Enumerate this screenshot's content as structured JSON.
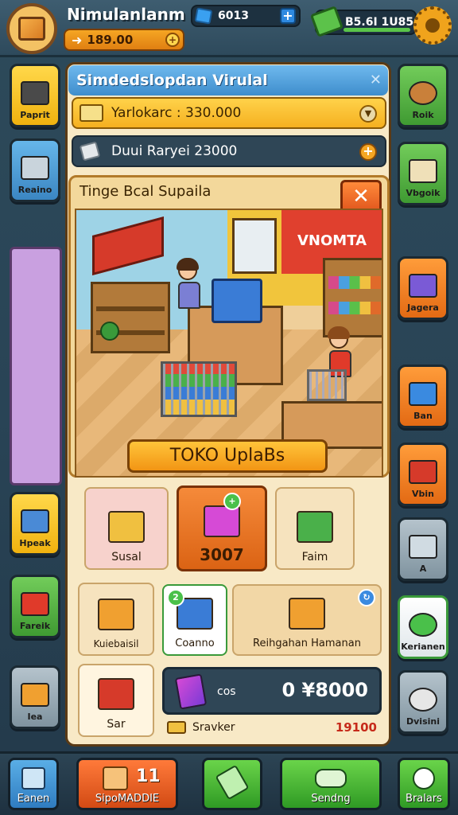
{
  "player": {
    "name": "Nimulanlanm",
    "coins": "189.00",
    "gems": "6013",
    "cash": "B5.6I 1U85"
  },
  "left_sidebar": [
    {
      "label": "Paprit",
      "icon": "trash-bin-icon",
      "color": "yellow"
    },
    {
      "label": "Reaino",
      "icon": "shopping-cart-icon",
      "color": "blue"
    },
    {
      "label": "Hpeak",
      "icon": "water-cooler-icon",
      "color": "yellow"
    },
    {
      "label": "Fareik",
      "icon": "cash-box-icon",
      "color": "green"
    },
    {
      "label": "Iea",
      "icon": "basket-icon",
      "color": "gray"
    }
  ],
  "right_sidebar": [
    {
      "label": "Roik",
      "icon": "dog-icon",
      "color": "green"
    },
    {
      "label": "Vbgoik",
      "icon": "paper-bag-icon",
      "color": "green"
    },
    {
      "label": "Jagera",
      "icon": "purple-box-icon",
      "color": "orange"
    },
    {
      "label": "Ban",
      "icon": "blue-box-icon",
      "color": "orange"
    },
    {
      "label": "Vbin",
      "icon": "red-machine-icon",
      "color": "orange"
    },
    {
      "label": "A",
      "icon": "card-reader-icon",
      "color": "gray"
    },
    {
      "label": "Kerianen",
      "icon": "download-arrow-icon",
      "color": "white"
    },
    {
      "label": "Dvisini",
      "icon": "robot-icon",
      "color": "gray"
    }
  ],
  "panel": {
    "title": "Simdedslopdan Virulal",
    "reward_text": "Yarlokarc : 330.000",
    "daily_text": "Duui Raryei 23000",
    "sub_title": "Tinge Bcal Supaila",
    "scene_sign": "VNOMTA",
    "upgrade_button": "TOKO UplaBs"
  },
  "items": [
    {
      "label": "Susal",
      "icon": "cart-icon"
    },
    {
      "label": "3007",
      "icon": "register-icon",
      "selected": true,
      "badge": "+"
    },
    {
      "label": "Faim",
      "icon": "money-stack-icon"
    },
    {
      "label": "Kuiebaisil",
      "icon": "basket-icon"
    },
    {
      "label": "Coanno",
      "icon": "blue-fridge-icon",
      "badge": "2"
    },
    {
      "label": "Reihgahan Hamanan",
      "icon": "crate-icon",
      "badge": "↻"
    },
    {
      "label": "Sar",
      "icon": "red-toolbox-icon"
    }
  ],
  "price": {
    "unit": "cos",
    "value": "0 ¥8000",
    "footer_label": "Sravker",
    "footer_value": "19100"
  },
  "bottom_nav": [
    {
      "label": "Eanen",
      "color": "blue"
    },
    {
      "label": "SipoMADDIE",
      "badge": "11",
      "color": "orange"
    },
    {
      "label": "",
      "color": "green"
    },
    {
      "label": "Sendng",
      "color": "green"
    },
    {
      "label": "Bralars",
      "color": "green"
    }
  ]
}
